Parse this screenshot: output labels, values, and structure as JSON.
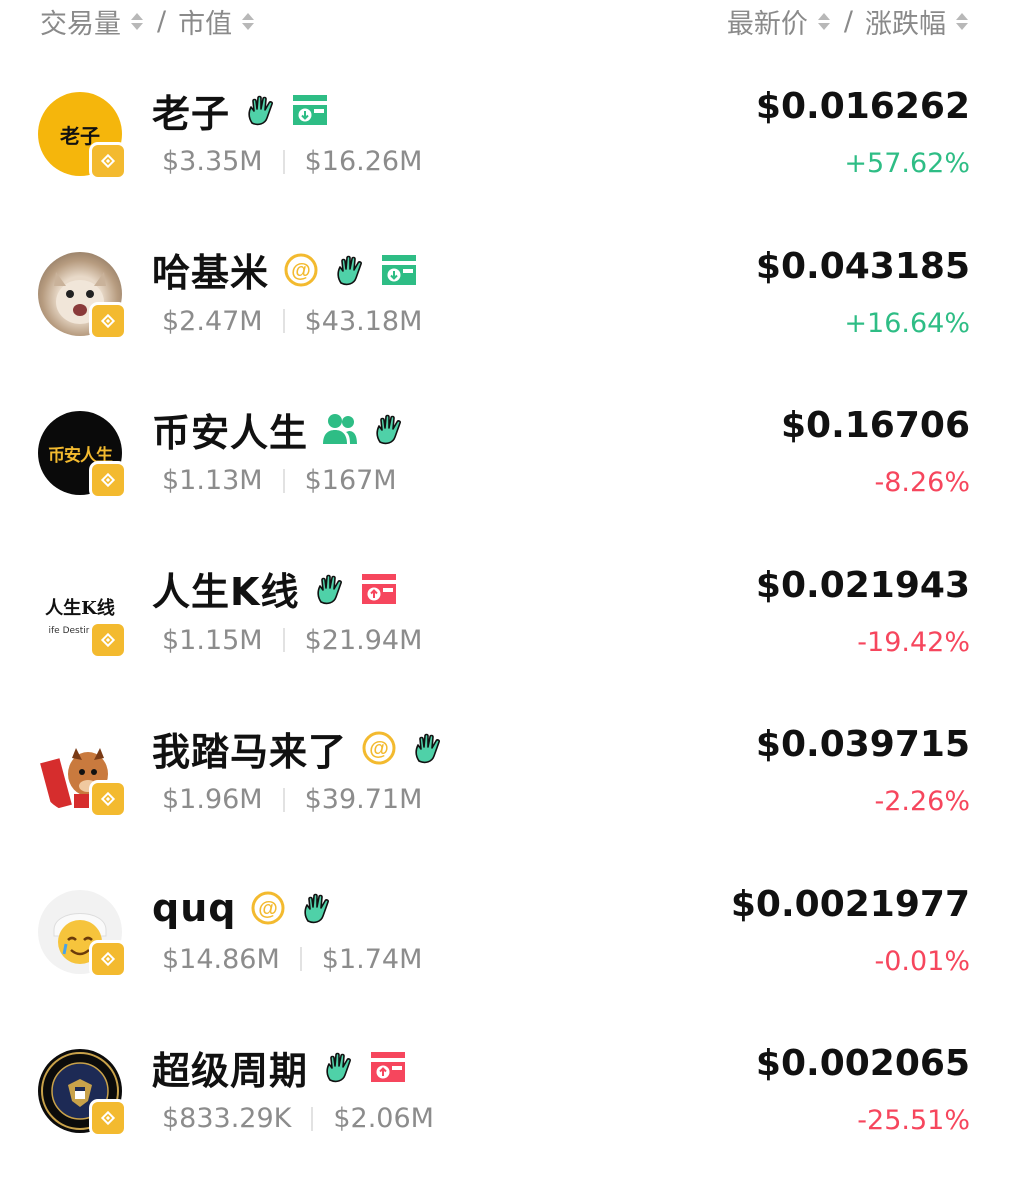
{
  "header": {
    "volume_label": "交易量",
    "market_cap_label": "市值",
    "price_label": "最新价",
    "change_label": "涨跌幅",
    "separator": "/"
  },
  "colors": {
    "up": "#2ebd85",
    "down": "#f6465d",
    "bnb_badge": "#f3ba2f",
    "tag_green": "#2ebd85",
    "tag_red": "#f6465d",
    "at_yellow": "#f3ba2f"
  },
  "tokens": [
    {
      "name": "老子",
      "avatar_text": "老子",
      "volume": "$3.35M",
      "market_cap": "$16.26M",
      "price": "$0.016262",
      "change": "+57.62%",
      "direction": "up",
      "icons": [
        "wave-hand-icon",
        "dex-inflow-icon"
      ]
    },
    {
      "name": "哈基米",
      "avatar_text": "",
      "volume": "$2.47M",
      "market_cap": "$43.18M",
      "price": "$0.043185",
      "change": "+16.64%",
      "direction": "up",
      "icons": [
        "at-icon",
        "wave-hand-icon",
        "dex-inflow-icon"
      ]
    },
    {
      "name": "币安人生",
      "avatar_text": "币安人生",
      "volume": "$1.13M",
      "market_cap": "$167M",
      "price": "$0.16706",
      "change": "-8.26%",
      "direction": "down",
      "icons": [
        "users-icon",
        "wave-hand-icon"
      ]
    },
    {
      "name": "人生K线",
      "avatar_text": "人生K线",
      "avatar_subtext": "ife Destin",
      "volume": "$1.15M",
      "market_cap": "$21.94M",
      "price": "$0.021943",
      "change": "-19.42%",
      "direction": "down",
      "icons": [
        "wave-hand-icon",
        "dex-outflow-icon"
      ]
    },
    {
      "name": "我踏马来了",
      "avatar_text": "",
      "volume": "$1.96M",
      "market_cap": "$39.71M",
      "price": "$0.039715",
      "change": "-2.26%",
      "direction": "down",
      "icons": [
        "at-icon",
        "wave-hand-icon"
      ]
    },
    {
      "name": "quq",
      "avatar_text": "",
      "volume": "$14.86M",
      "market_cap": "$1.74M",
      "price": "$0.0021977",
      "change": "-0.01%",
      "direction": "down",
      "icons": [
        "at-icon",
        "wave-hand-icon"
      ]
    },
    {
      "name": "超级周期",
      "avatar_text": "",
      "volume": "$833.29K",
      "market_cap": "$2.06M",
      "price": "$0.002065",
      "change": "-25.51%",
      "direction": "down",
      "icons": [
        "wave-hand-icon",
        "dex-outflow-icon"
      ]
    }
  ]
}
